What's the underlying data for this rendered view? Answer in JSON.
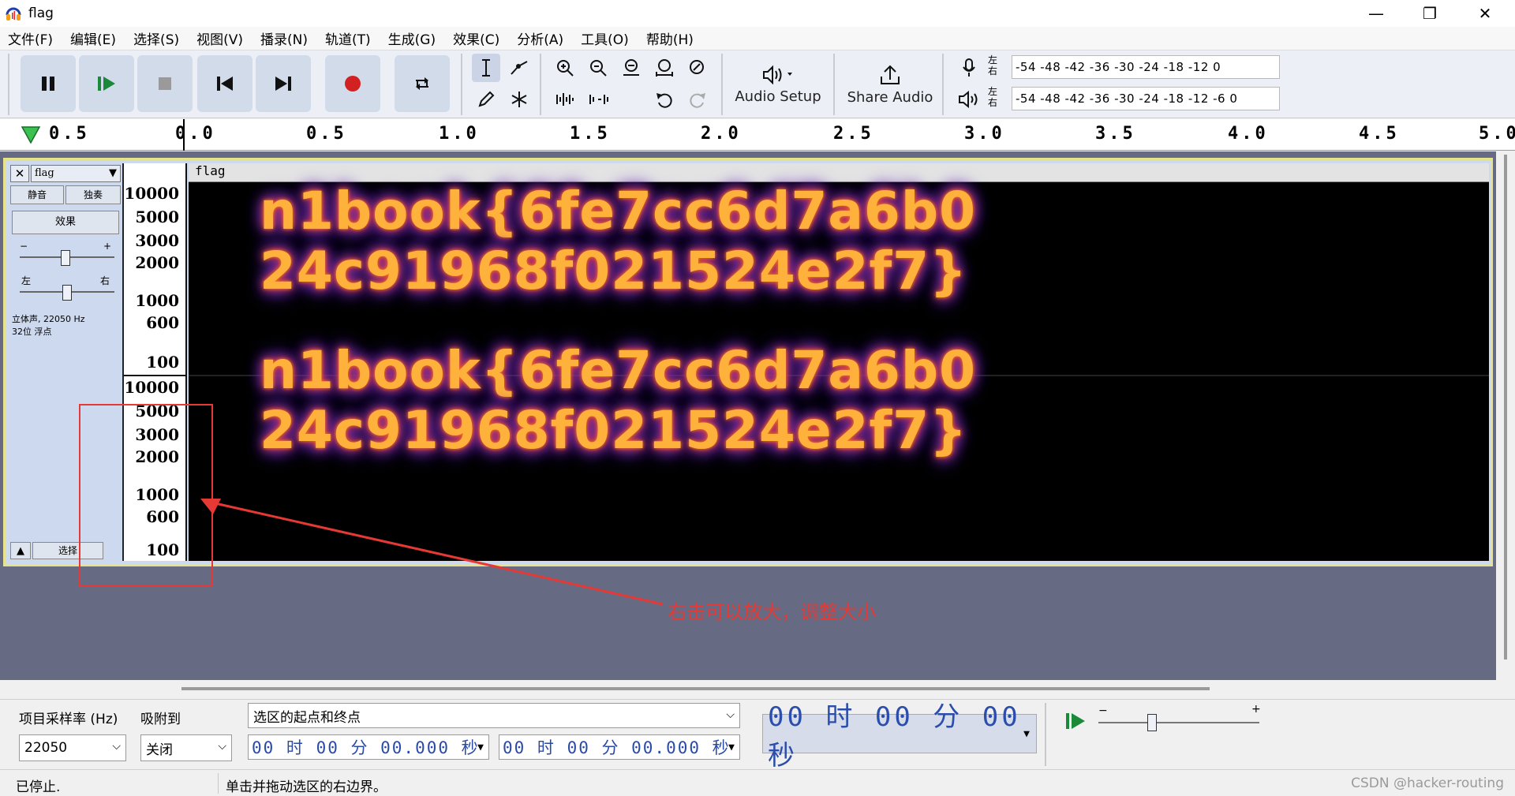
{
  "window": {
    "title": "flag",
    "minimize": "—",
    "maximize": "❐",
    "close": "✕"
  },
  "menu": [
    "文件(F)",
    "编辑(E)",
    "选择(S)",
    "视图(V)",
    "播录(N)",
    "轨道(T)",
    "生成(G)",
    "效果(C)",
    "分析(A)",
    "工具(O)",
    "帮助(H)"
  ],
  "toolbar": {
    "audio_setup_label": "Audio Setup",
    "share_audio_label": "Share Audio",
    "meter_lr_top": "左\n右",
    "meter_scale_record": "-54 -48 -42 -36 -30 -24 -18 -12   0",
    "meter_scale_play": "-54 -48 -42 -36 -30 -24 -18 -12 -6 0"
  },
  "ruler": {
    "labels": [
      "0.5",
      "0.0",
      "0.5",
      "1.0",
      "1.5",
      "2.0",
      "2.5",
      "3.0",
      "3.5",
      "4.0",
      "4.5",
      "5.0"
    ]
  },
  "track": {
    "name": "flag",
    "mute_label": "静音",
    "solo_label": "独奏",
    "effects_label": "效果",
    "gain_minus": "−",
    "gain_plus": "+",
    "pan_left": "左",
    "pan_right": "右",
    "info_line1": "立体声, 22050 Hz",
    "info_line2": "32位 浮点",
    "select_label": "选择",
    "clip_title": "flag",
    "vruler_top": [
      "10000",
      "5000",
      "3000",
      "2000",
      "1000",
      "600",
      "100"
    ],
    "vruler_bottom": [
      "10000",
      "5000",
      "3000",
      "2000",
      "1000",
      "600",
      "100"
    ],
    "spectrogram_line1": "n1book{6fe7cc6d7a6b0",
    "spectrogram_line2": "24c91968f021524e2f7}"
  },
  "annotation": {
    "text": "右击可以放大，调整大小",
    "color": "#e53935"
  },
  "bottom": {
    "rate_label": "项目采样率 (Hz)",
    "rate_value": "22050",
    "snap_label": "吸附到",
    "snap_value": "关闭",
    "selection_mode": "选区的起点和终点",
    "sel_start": "00 时 00 分 00.000 秒",
    "sel_end": "00 时 00 分 00.000 秒",
    "big_time": "00 时 00 分 00 秒"
  },
  "status": {
    "state": "已停止.",
    "hint": "单击并拖动选区的右边界。",
    "watermark": "CSDN @hacker-routing"
  }
}
